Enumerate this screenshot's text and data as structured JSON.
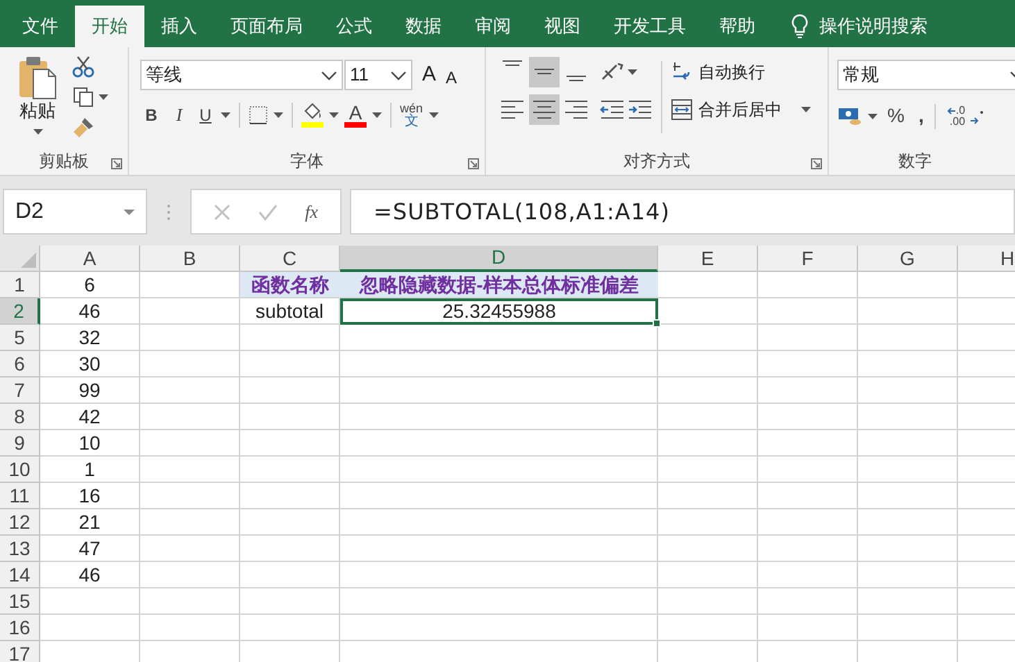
{
  "tabs": [
    {
      "label": "文件",
      "selected": false
    },
    {
      "label": "开始",
      "selected": true
    },
    {
      "label": "插入",
      "selected": false
    },
    {
      "label": "页面布局",
      "selected": false
    },
    {
      "label": "公式",
      "selected": false
    },
    {
      "label": "数据",
      "selected": false
    },
    {
      "label": "审阅",
      "selected": false
    },
    {
      "label": "视图",
      "selected": false
    },
    {
      "label": "开发工具",
      "selected": false
    },
    {
      "label": "帮助",
      "selected": false
    }
  ],
  "tell_me": "操作说明搜索",
  "clipboard": {
    "paste": "粘贴",
    "label": "剪贴板"
  },
  "font": {
    "name": "等线",
    "size": "11",
    "grow": "A",
    "shrink": "A",
    "styles": [
      "B",
      "I",
      "U"
    ],
    "font_color": "A",
    "phonetic_top": "wén",
    "phonetic_bottom": "文",
    "label": "字体"
  },
  "alignment": {
    "vertical": [
      {
        "selected": false
      },
      {
        "selected": true
      },
      {
        "selected": false
      }
    ],
    "horizontal": [
      {
        "selected": false
      },
      {
        "selected": true
      },
      {
        "selected": false
      }
    ],
    "wrap": "自动换行",
    "merge": "合并后居中",
    "label": "对齐方式"
  },
  "number": {
    "format": "常规",
    "percent": "%",
    "comma": ",",
    "decimal_top": ".0",
    "decimal_bottom": ".00",
    "label": "数字"
  },
  "formula_bar": {
    "name_box": "D2",
    "function_label": "fx",
    "formula": "=SUBTOTAL(108,A1:A14)"
  },
  "columns": [
    {
      "label": "A",
      "selected": false
    },
    {
      "label": "B",
      "selected": false
    },
    {
      "label": "C",
      "selected": false
    },
    {
      "label": "D",
      "selected": true
    },
    {
      "label": "E",
      "selected": false
    },
    {
      "label": "F",
      "selected": false
    },
    {
      "label": "G",
      "selected": false
    },
    {
      "label": "H",
      "selected": false
    }
  ],
  "rows": [
    {
      "label": "1",
      "selected": false,
      "cells": [
        {
          "text": "6",
          "kind": "value",
          "selected": false
        },
        null,
        {
          "text": "函数名称",
          "kind": "heading",
          "selected": false
        },
        {
          "text": "忽略隐藏数据-样本总体标准偏差",
          "kind": "heading",
          "selected": false
        },
        null,
        null,
        null,
        null
      ]
    },
    {
      "label": "2",
      "selected": true,
      "cells": [
        {
          "text": "46",
          "kind": "value",
          "selected": false
        },
        null,
        {
          "text": "subtotal",
          "kind": "value",
          "selected": false
        },
        {
          "text": "25.32455988",
          "kind": "value",
          "selected": true
        },
        null,
        null,
        null,
        null
      ]
    },
    {
      "label": "5",
      "selected": false,
      "cells": [
        {
          "text": "32",
          "kind": "value",
          "selected": false
        },
        null,
        null,
        null,
        null,
        null,
        null,
        null
      ]
    },
    {
      "label": "6",
      "selected": false,
      "cells": [
        {
          "text": "30",
          "kind": "value",
          "selected": false
        },
        null,
        null,
        null,
        null,
        null,
        null,
        null
      ]
    },
    {
      "label": "7",
      "selected": false,
      "cells": [
        {
          "text": "99",
          "kind": "value",
          "selected": false
        },
        null,
        null,
        null,
        null,
        null,
        null,
        null
      ]
    },
    {
      "label": "8",
      "selected": false,
      "cells": [
        {
          "text": "42",
          "kind": "value",
          "selected": false
        },
        null,
        null,
        null,
        null,
        null,
        null,
        null
      ]
    },
    {
      "label": "9",
      "selected": false,
      "cells": [
        {
          "text": "10",
          "kind": "value",
          "selected": false
        },
        null,
        null,
        null,
        null,
        null,
        null,
        null
      ]
    },
    {
      "label": "10",
      "selected": false,
      "cells": [
        {
          "text": "1",
          "kind": "value",
          "selected": false
        },
        null,
        null,
        null,
        null,
        null,
        null,
        null
      ]
    },
    {
      "label": "11",
      "selected": false,
      "cells": [
        {
          "text": "16",
          "kind": "value",
          "selected": false
        },
        null,
        null,
        null,
        null,
        null,
        null,
        null
      ]
    },
    {
      "label": "12",
      "selected": false,
      "cells": [
        {
          "text": "21",
          "kind": "value",
          "selected": false
        },
        null,
        null,
        null,
        null,
        null,
        null,
        null
      ]
    },
    {
      "label": "13",
      "selected": false,
      "cells": [
        {
          "text": "47",
          "kind": "value",
          "selected": false
        },
        null,
        null,
        null,
        null,
        null,
        null,
        null
      ]
    },
    {
      "label": "14",
      "selected": false,
      "cells": [
        {
          "text": "46",
          "kind": "value",
          "selected": false
        },
        null,
        null,
        null,
        null,
        null,
        null,
        null
      ]
    },
    {
      "label": "15",
      "selected": false,
      "cells": [
        null,
        null,
        null,
        null,
        null,
        null,
        null,
        null
      ]
    },
    {
      "label": "16",
      "selected": false,
      "cells": [
        null,
        null,
        null,
        null,
        null,
        null,
        null,
        null
      ]
    },
    {
      "label": "17",
      "selected": false,
      "cells": [
        null,
        null,
        null,
        null,
        null,
        null,
        null,
        null
      ]
    }
  ]
}
